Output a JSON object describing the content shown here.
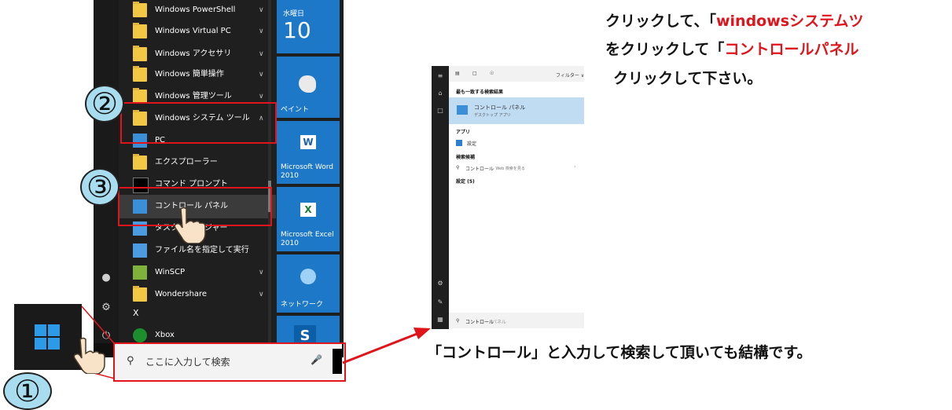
{
  "start_menu": {
    "apps": [
      {
        "label": "Windows PowerShell",
        "chevron": "∨"
      },
      {
        "label": "Windows Virtual PC",
        "chevron": "∨"
      },
      {
        "label": "Windows アクセサリ",
        "chevron": "∨"
      },
      {
        "label": "Windows 簡単操作",
        "chevron": "∨"
      },
      {
        "label": "Windows 管理ツール",
        "chevron": "∨"
      },
      {
        "label": "Windows システム ツール",
        "chevron": "∧"
      },
      {
        "label": "PC",
        "chevron": ""
      },
      {
        "label": "エクスプローラー",
        "chevron": ""
      },
      {
        "label": "コマンド プロンプト",
        "chevron": ""
      },
      {
        "label": "コントロール パネル",
        "chevron": ""
      },
      {
        "label": "タスク マネージャー",
        "chevron": ""
      },
      {
        "label": "ファイル名を指定して実行",
        "chevron": ""
      },
      {
        "label": "WinSCP",
        "chevron": "∨"
      },
      {
        "label": "Wondershare",
        "chevron": "∨"
      },
      {
        "label": "X",
        "chevron": ""
      },
      {
        "label": "Xbox",
        "chevron": ""
      }
    ],
    "tiles": {
      "calendar_day": "水曜日",
      "calendar_date": "10",
      "paint": "ペイント",
      "word": "Microsoft Word 2010",
      "excel": "Microsoft Excel 2010",
      "network": "ネットワーク"
    },
    "search_placeholder": "ここに入力して検索"
  },
  "search_panel": {
    "filter": "フィルター ∨",
    "best_match_heading": "最も一致する検索結果",
    "best_match_title": "コントロール パネル",
    "best_match_sub": "デスクトップ アプリ",
    "apps_heading": "アプリ",
    "settings_app": "設定",
    "suggest_heading": "検索候補",
    "web_suggest": "コントロール",
    "web_suggest_sub": "- Web 検索を見る",
    "settings_count": "設定 (5)",
    "query_typed": "コントロール",
    "query_hint": "パネル"
  },
  "annotations": {
    "step1": "①",
    "step2": "②",
    "step3": "③",
    "line1_pre": "クリックして、「",
    "line1_red": "windowsシステムツ",
    "line2_pre": "をクリックして「",
    "line2_red": "コントロールパネル",
    "line3": "クリックして下さい。",
    "bottom": "「コントロール」と入力して検索して頂いても結構です。"
  },
  "colors": {
    "accent": "#e0151b",
    "tile_blue": "#1e78c8",
    "highlight_blue": "#bfdcf3",
    "circle_fill": "#a8dcef"
  }
}
